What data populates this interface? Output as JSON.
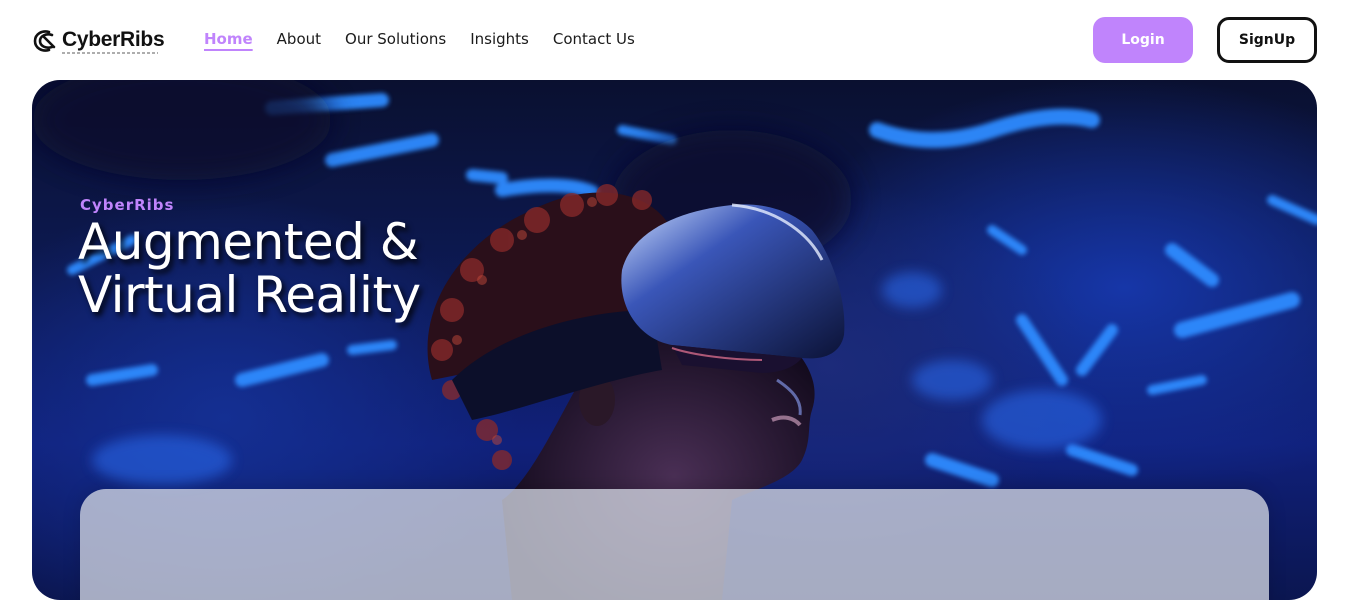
{
  "brand": {
    "name": "CyberRibs",
    "logo_icon": "cyberribs-logo-icon"
  },
  "nav": {
    "links": [
      {
        "label": "Home",
        "active": true
      },
      {
        "label": "About",
        "active": false
      },
      {
        "label": "Our Solutions",
        "active": false
      },
      {
        "label": "Insights",
        "active": false
      },
      {
        "label": "Contact Us",
        "active": false
      }
    ],
    "login_label": "Login",
    "signup_label": "SignUp"
  },
  "hero": {
    "eyebrow": "CyberRibs",
    "title_line1": "Augmented &",
    "title_line2": "Virtual Reality",
    "image": "person-wearing-vr-headset-neon-blue-background"
  },
  "colors": {
    "accent": "#c084fc",
    "hero_blue": "#1636a8",
    "text_dark": "#111111"
  }
}
